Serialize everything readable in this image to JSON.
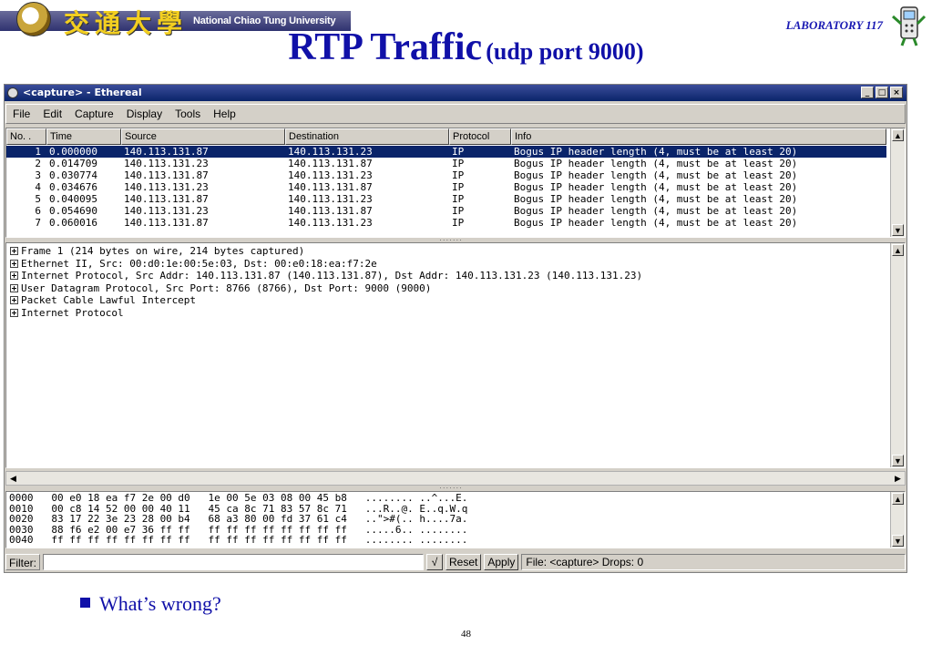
{
  "header": {
    "logo_cjk": "交通大學",
    "logo_university": "National Chiao Tung University",
    "lab": "LABORATORY 117",
    "title_main": "RTP Traffic",
    "title_sub": "(udp port 9000)"
  },
  "window": {
    "title": "<capture> - Ethereal",
    "controls": [
      "_",
      "□",
      "×"
    ]
  },
  "menu": [
    "File",
    "Edit",
    "Capture",
    "Display",
    "Tools",
    "Help"
  ],
  "packet_list": {
    "columns": [
      "No. .",
      "Time",
      "Source",
      "Destination",
      "Protocol",
      "Info"
    ],
    "rows": [
      [
        "1",
        "0.000000",
        "140.113.131.87",
        "140.113.131.23",
        "IP",
        "Bogus IP header length (4, must be at least 20)"
      ],
      [
        "2",
        "0.014709",
        "140.113.131.23",
        "140.113.131.87",
        "IP",
        "Bogus IP header length (4, must be at least 20)"
      ],
      [
        "3",
        "0.030774",
        "140.113.131.87",
        "140.113.131.23",
        "IP",
        "Bogus IP header length (4, must be at least 20)"
      ],
      [
        "4",
        "0.034676",
        "140.113.131.23",
        "140.113.131.87",
        "IP",
        "Bogus IP header length (4, must be at least 20)"
      ],
      [
        "5",
        "0.040095",
        "140.113.131.87",
        "140.113.131.23",
        "IP",
        "Bogus IP header length (4, must be at least 20)"
      ],
      [
        "6",
        "0.054690",
        "140.113.131.23",
        "140.113.131.87",
        "IP",
        "Bogus IP header length (4, must be at least 20)"
      ],
      [
        "7",
        "0.060016",
        "140.113.131.87",
        "140.113.131.23",
        "IP",
        "Bogus IP header length (4, must be at least 20)"
      ]
    ],
    "selected_index": 0
  },
  "detail_tree": [
    "Frame 1 (214 bytes on wire, 214 bytes captured)",
    "Ethernet II, Src: 00:d0:1e:00:5e:03, Dst: 00:e0:18:ea:f7:2e",
    "Internet Protocol, Src Addr: 140.113.131.87 (140.113.131.87), Dst Addr: 140.113.131.23 (140.113.131.23)",
    "User Datagram Protocol, Src Port: 8766 (8766), Dst Port: 9000 (9000)",
    "Packet Cable Lawful Intercept",
    "Internet Protocol"
  ],
  "hex_dump": [
    "0000   00 e0 18 ea f7 2e 00 d0   1e 00 5e 03 08 00 45 b8   ........ ..^...E.",
    "0010   00 c8 14 52 00 00 40 11   45 ca 8c 71 83 57 8c 71   ...R..@. E..q.W.q",
    "0020   83 17 22 3e 23 28 00 b4   68 a3 80 00 fd 37 61 c4   ..\">#(.. h....7a.",
    "0030   88 f6 e2 00 e7 36 ff ff   ff ff ff ff ff ff ff ff   .....6.. ........",
    "0040   ff ff ff ff ff ff ff ff   ff ff ff ff ff ff ff ff   ........ ........"
  ],
  "status": {
    "filter_label": "Filter:",
    "filter_value": "",
    "check_glyph": "√",
    "reset": "Reset",
    "apply": "Apply",
    "info": "File: <capture>  Drops: 0"
  },
  "footer": {
    "bullet": "What’s wrong?",
    "page": "48"
  }
}
